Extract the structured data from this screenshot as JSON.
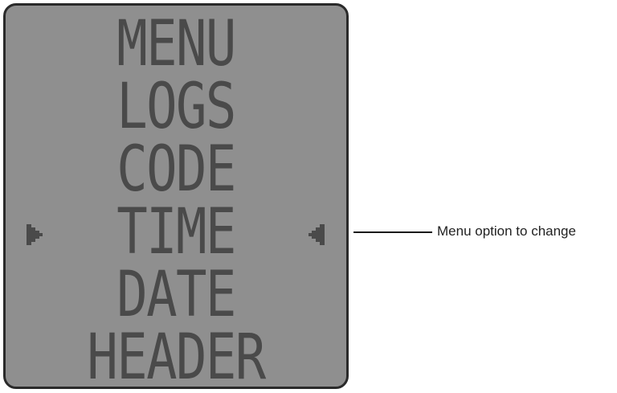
{
  "lcd": {
    "lines": [
      "MENU",
      "LOGS",
      "CODE",
      "TIME",
      "DATE",
      "HEADER"
    ],
    "selected_index": 3,
    "left_indicator_icon": "right-pointing-arrow-icon",
    "right_indicator_icon": "left-pointing-arrow-icon"
  },
  "callout": {
    "text": "Menu option to change"
  },
  "colors": {
    "screen_background": "#8f8f8f",
    "screen_text": "#4a4a4a",
    "bezel": "#2a2a2a"
  }
}
